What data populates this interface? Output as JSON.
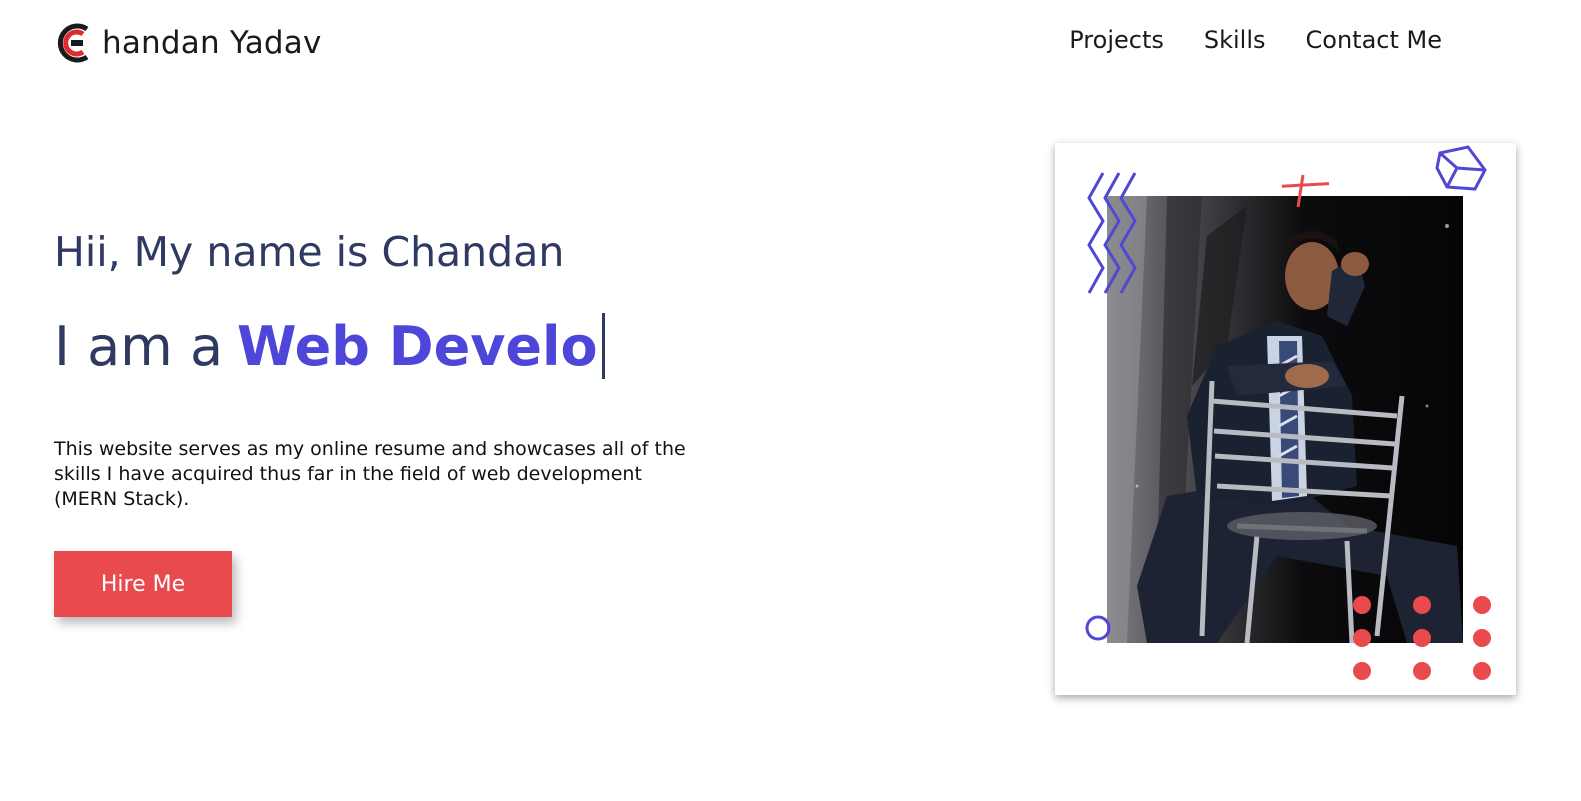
{
  "header": {
    "logo_text": "handan Yadav",
    "logo_icon": "c-letter-logo-icon",
    "nav": [
      "Projects",
      "Skills",
      "Contact Me"
    ]
  },
  "hero": {
    "greeting": "Hii, My name is Chandan",
    "role_prefix": "I am a",
    "role_typed": "Web Develo",
    "description": "This website serves as my online resume and showcases all of the skills I have acquired thus far in the field of web development (MERN Stack).",
    "hire_button": "Hire Me"
  },
  "colors": {
    "accent_red": "#e84a4d",
    "accent_purple": "#4e46d8",
    "heading_navy": "#2f3a63"
  }
}
